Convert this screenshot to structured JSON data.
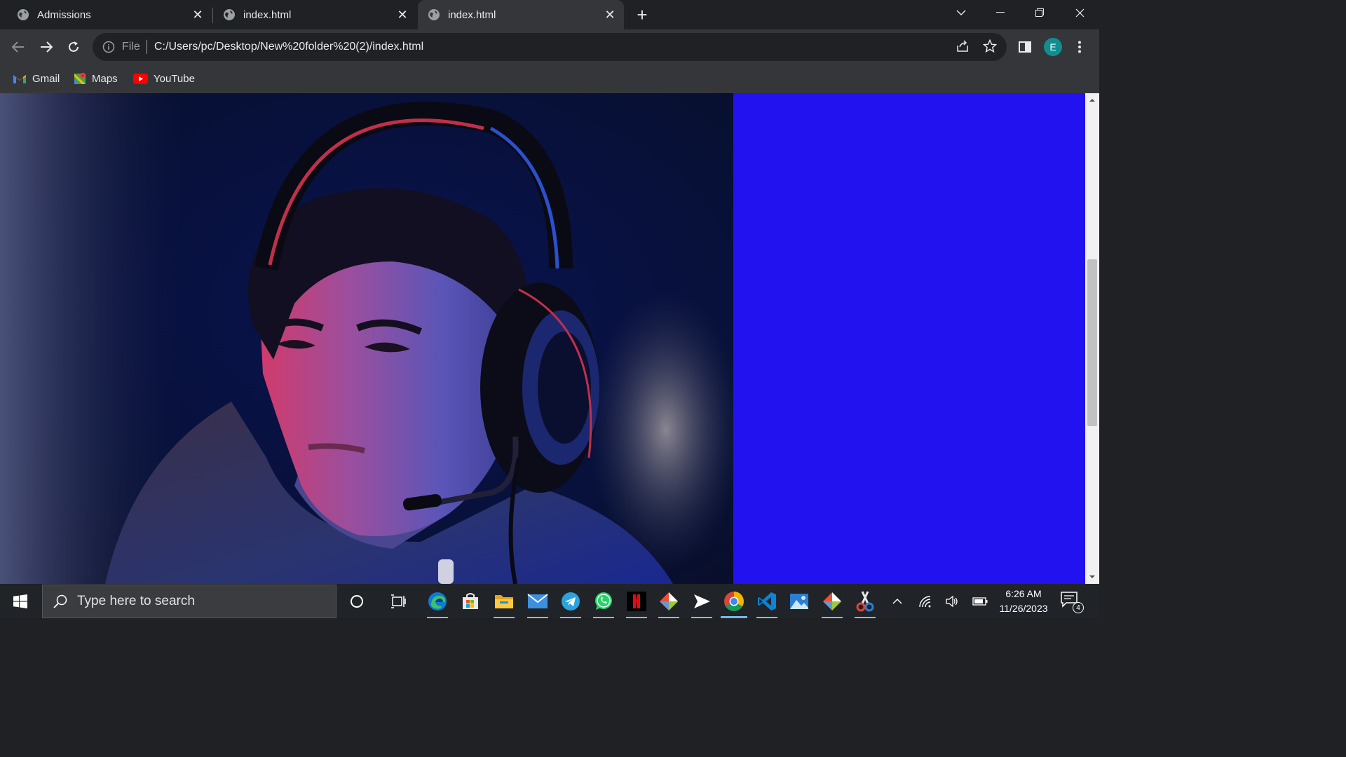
{
  "browser": {
    "tabs": [
      {
        "title": "Admissions",
        "active": false
      },
      {
        "title": "index.html",
        "active": false
      },
      {
        "title": "index.html",
        "active": true
      }
    ],
    "omnibox": {
      "scheme_label": "File",
      "url": "C:/Users/pc/Desktop/New%20folder%20(2)/index.html"
    },
    "profile_initial": "E",
    "bookmarks": [
      {
        "label": "Gmail",
        "icon": "gmail-icon"
      },
      {
        "label": "Maps",
        "icon": "maps-icon"
      },
      {
        "label": "YouTube",
        "icon": "youtube-icon"
      }
    ]
  },
  "page": {
    "photo": {
      "subject": "young man wearing gaming headset with microphone, lit by red and blue light"
    },
    "panel_color": "#2212f0"
  },
  "taskbar": {
    "search_placeholder": "Type here to search",
    "apps": [
      "cortana-icon",
      "task-view-icon",
      "edge-icon",
      "store-icon",
      "file-explorer-icon",
      "mail-icon",
      "telegram-icon",
      "whatsapp-icon",
      "netflix-icon",
      "git-icon",
      "media-player-icon",
      "chrome-icon",
      "vscode-icon",
      "photos-icon",
      "git-gui-icon",
      "snipping-tool-icon"
    ],
    "time": "6:26 AM",
    "date": "11/26/2023",
    "notification_count": "4"
  },
  "colors": {
    "chrome_dark": "#202124",
    "toolbar": "#35363a",
    "accent_blue": "#2212f0"
  }
}
